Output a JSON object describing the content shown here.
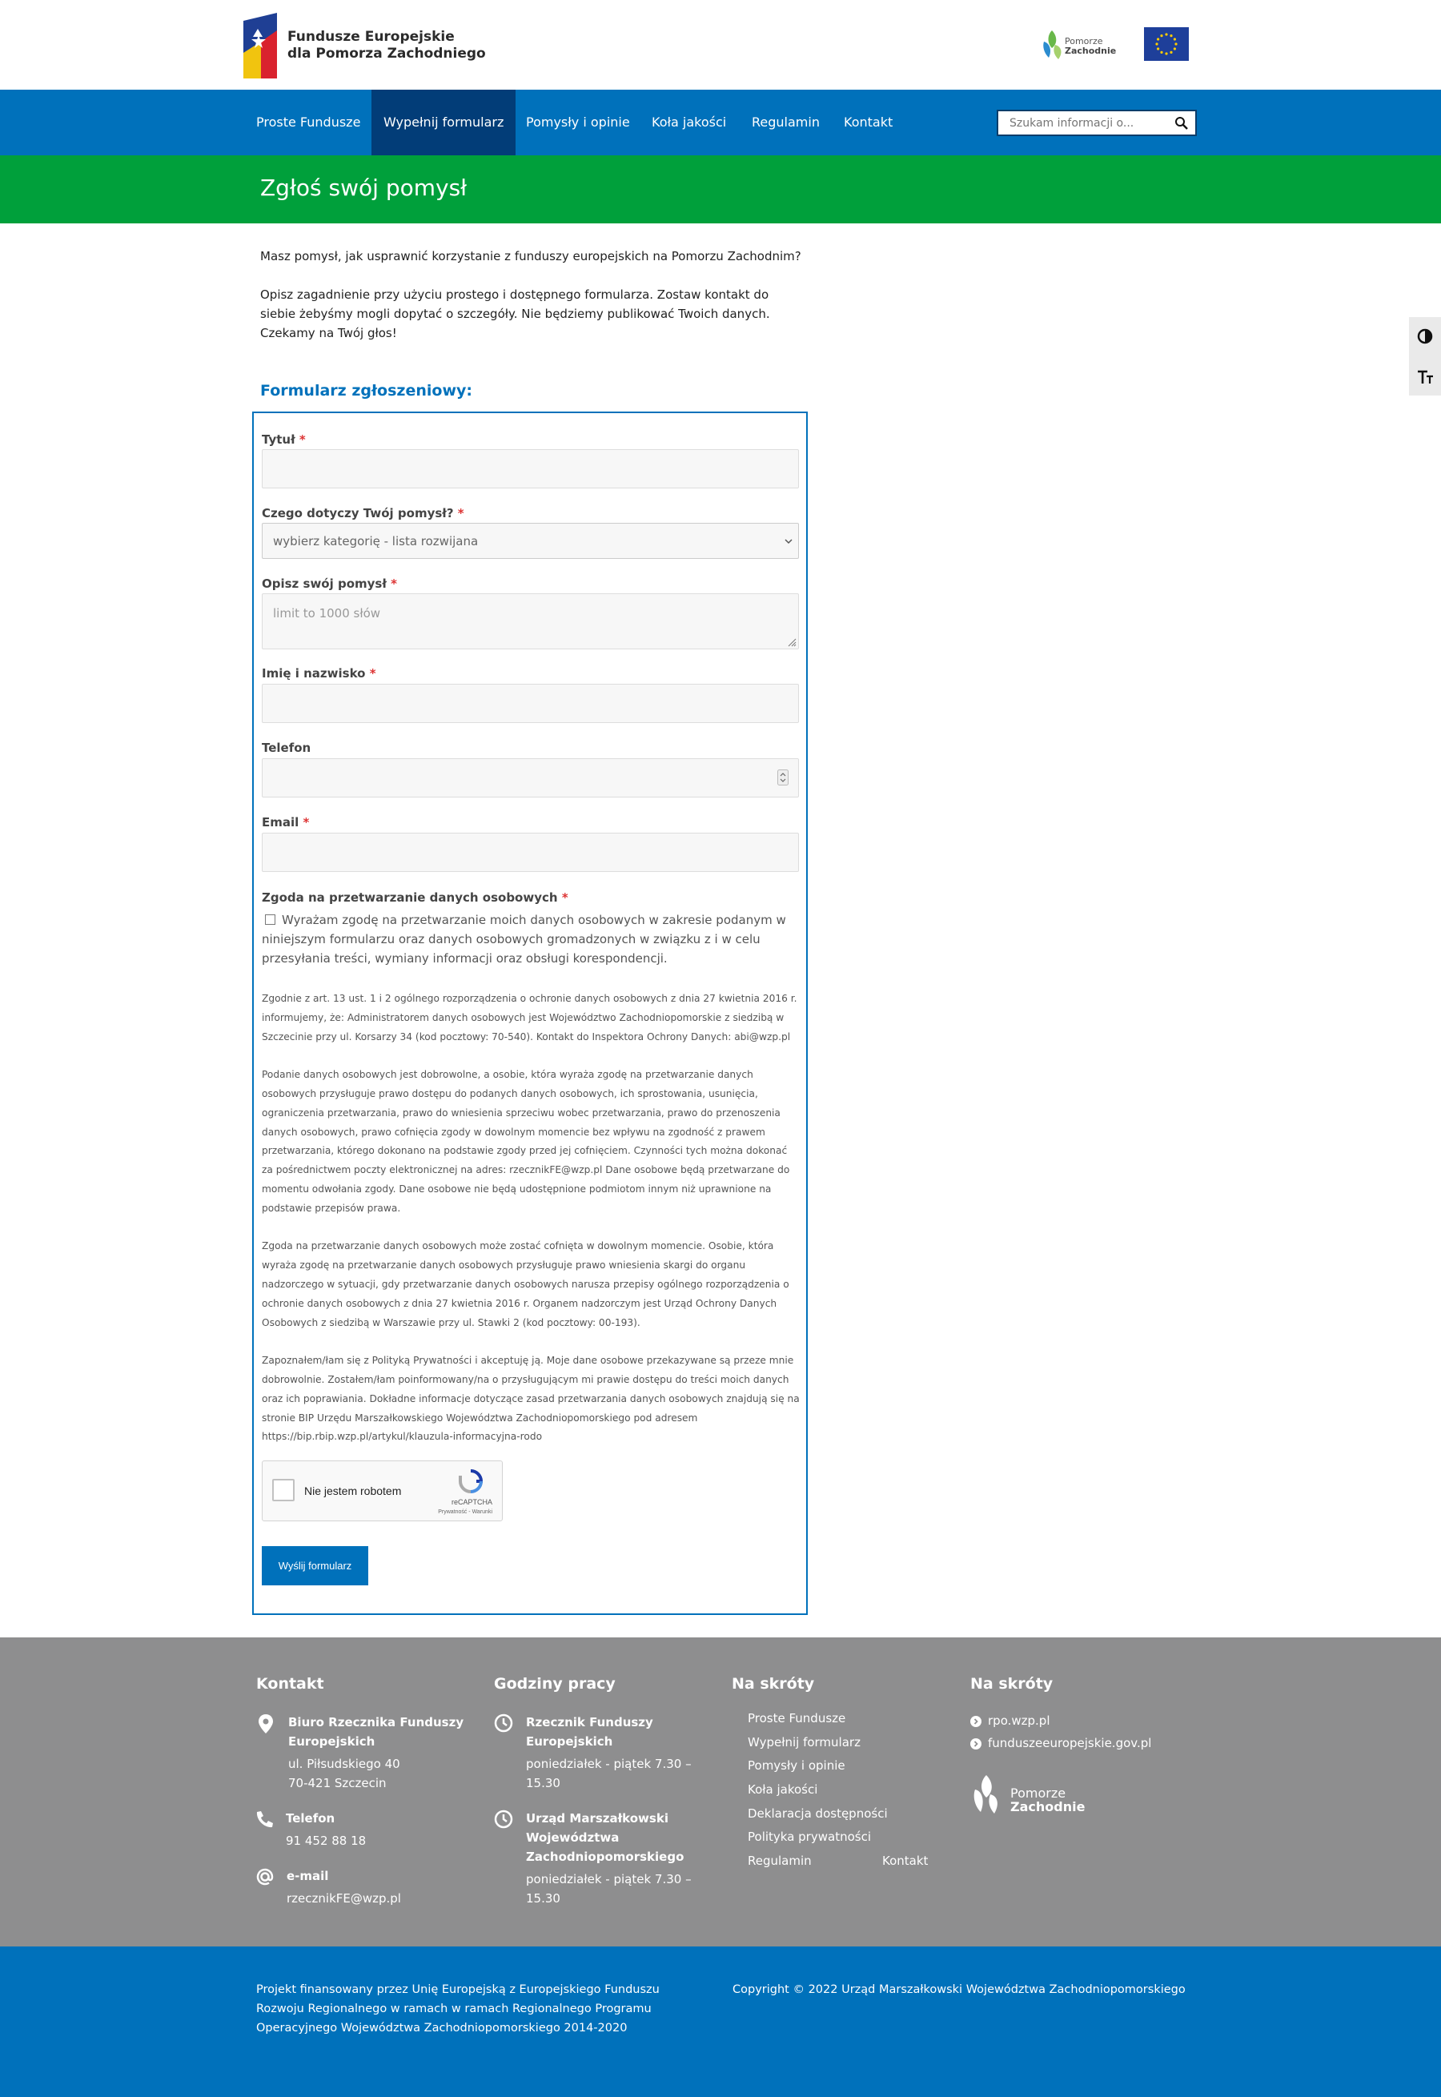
{
  "header": {
    "logo_text_line1": "Fundusze Europejskie",
    "logo_text_line2": "dla Pomorza Zachodniego",
    "pomorze_line1": "Pomorze",
    "pomorze_line2": "Zachodnie"
  },
  "nav": {
    "items": [
      {
        "label": "Proste Fundusze"
      },
      {
        "label": "Wypełnij formularz"
      },
      {
        "label": "Pomysły i opinie"
      },
      {
        "label": "Koła jakości"
      },
      {
        "label": "Regulamin"
      },
      {
        "label": "Kontakt"
      }
    ],
    "active_index": 1,
    "search_placeholder": "Szukam informacji o..."
  },
  "page": {
    "title": "Zgłoś swój pomysł",
    "intro_1": "Masz pomysł, jak usprawnić korzystanie z funduszy europejskich na Pomorzu Zachodnim?",
    "intro_2": "Opisz zagadnienie przy użyciu prostego i dostępnego formularza. Zostaw kontakt do siebie żebyśmy mogli dopytać o szczegóły. Nie będziemy publikować Twoich danych. Czekamy na Twój głos!"
  },
  "form": {
    "heading": "Formularz zgłoszeniowy:",
    "required_mark": "*",
    "title_label": "Tytuł",
    "category_label": "Czego dotyczy Twój pomysł?",
    "category_value": "wybierz kategorię - lista rozwijana",
    "description_label": "Opisz swój pomysł",
    "description_placeholder": "limit to 1000 słów",
    "name_label": "Imię i nazwisko",
    "phone_label": "Telefon",
    "email_label": "Email",
    "consent_label": "Zgoda na przetwarzanie danych osobowych",
    "consent_text": "Wyrażam zgodę na przetwarzanie moich danych osobowych w zakresie podanym w niniejszym formularzu oraz danych osobowych gromadzonych w związku z i w celu przesyłania treści, wymiany informacji oraz obsługi korespondencji.",
    "legal_1": "Zgodnie z art. 13 ust. 1 i 2 ogólnego rozporządzenia o ochronie danych osobowych z dnia 27 kwietnia 2016 r. informujemy, że: Administratorem danych osobowych jest Województwo Zachodniopomorskie z siedzibą w Szczecinie przy ul. Korsarzy 34 (kod pocztowy: 70-540). Kontakt do Inspektora Ochrony Danych: abi@wzp.pl",
    "legal_2": "Podanie danych osobowych jest dobrowolne, a osobie, która wyraża zgodę na przetwarzanie danych osobowych przysługuje prawo dostępu do podanych danych osobowych, ich sprostowania, usunięcia, ograniczenia przetwarzania, prawo do wniesienia sprzeciwu wobec przetwarzania, prawo do przenoszenia danych osobowych, prawo cofnięcia zgody w dowolnym momencie bez wpływu na zgodność z prawem przetwarzania, którego dokonano na podstawie zgody przed jej cofnięciem. Czynności tych można dokonać za pośrednictwem poczty elektronicznej na adres: rzecznikFE@wzp.pl Dane osobowe będą przetwarzane do momentu odwołania zgody. Dane osobowe nie będą udostępnione podmiotom innym niż uprawnione na podstawie przepisów prawa.",
    "legal_3": "Zgoda na przetwarzanie danych osobowych może zostać cofnięta w dowolnym momencie. Osobie, która wyraża zgodę na przetwarzanie danych osobowych przysługuje prawo wniesienia skargi do organu nadzorczego w sytuacji, gdy przetwarzanie danych osobowych narusza przepisy ogólnego rozporządzenia o ochronie danych osobowych z dnia 27 kwietnia 2016 r. Organem nadzorczym jest Urząd Ochrony Danych Osobowych z siedzibą w Warszawie przy ul. Stawki 2 (kod pocztowy: 00-193).",
    "legal_4": "Zapoznałem/łam się z Polityką Prywatności i akceptuję ją. Moje dane osobowe przekazywane są przeze mnie dobrowolnie. Zostałem/łam poinformowany/na o przysługującym mi prawie dostępu do treści moich danych oraz ich poprawiania. Dokładne informacje dotyczące zasad przetwarzania danych osobowych znajdują się na stronie BIP Urzędu Marszałkowskiego Województwa Zachodniopomorskiego pod adresem https://bip.rbip.wzp.pl/artykul/klauzula-informacyjna-rodo",
    "captcha_label": "Nie jestem robotem",
    "captcha_brand": "reCAPTCHA",
    "captcha_terms": "Prywatność - Warunki",
    "submit_label": "Wyślij formularz"
  },
  "footer": {
    "col1_heading": "Kontakt",
    "office_name": "Biuro Rzecznika Funduszy Europejskich",
    "office_street": "ul. Piłsudskiego 40",
    "office_city": "70-421 Szczecin",
    "phone_label": "Telefon",
    "phone_value": "91 452 88 18",
    "email_label": "e-mail",
    "email_value": "rzecznikFE@wzp.pl",
    "col2_heading": "Godziny pracy",
    "hours1_name": "Rzecznik Funduszy Europejskich",
    "hours1_value": "poniedziałek - piątek 7.30 – 15.30",
    "hours2_name": "Urząd Marszałkowski Województwa Zachodniopomorskiego",
    "hours2_value": "poniedziałek - piątek 7.30 – 15.30",
    "col3_heading": "Na skróty",
    "col3_links": [
      "Proste Fundusze",
      "Wypełnij formularz",
      "Pomysły i opinie",
      "Koła jakości",
      "Deklaracja dostępności",
      "Polityka prywatności",
      "Regulamin",
      "Kontakt"
    ],
    "col4_heading": "Na skróty",
    "col4_links": [
      "rpo.wzp.pl",
      "funduszeeuropejskie.gov.pl"
    ],
    "pomorze_line1": "Pomorze",
    "pomorze_line2": "Zachodnie"
  },
  "bottom": {
    "funding_text": "Projekt finansowany przez Unię Europejską z Europejskiego Funduszu Rozwoju Regionalnego w ramach w ramach Regionalnego Programu Operacyjnego Województwa Zachodniopomorskiego 2014-2020",
    "copyright": "Copyright © 2022 Urząd Marszałkowski Województwa Zachodniopomorskiego"
  },
  "colors": {
    "nav_blue": "#0071bb",
    "nav_active": "#023d78",
    "banner_green": "#00a03b",
    "footer_gray": "#8e8e8f"
  }
}
